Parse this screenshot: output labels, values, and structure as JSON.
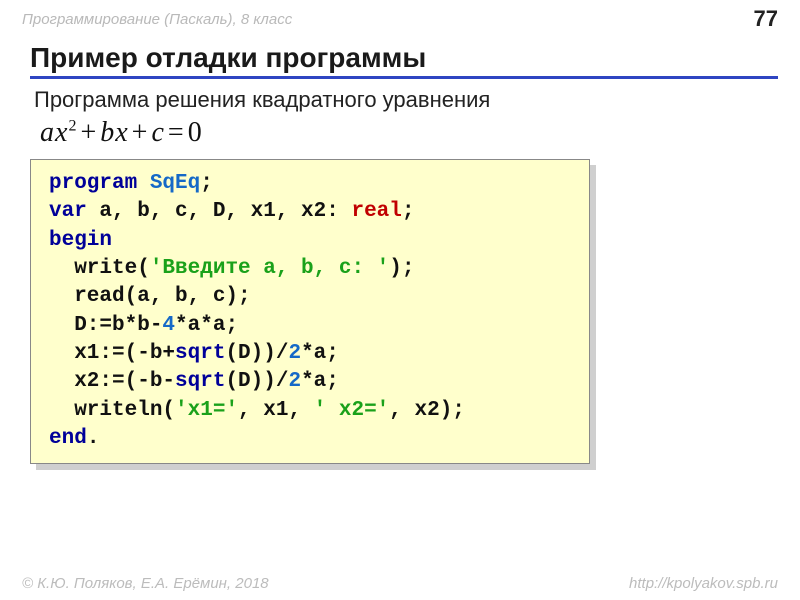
{
  "header": {
    "course": "Программирование (Паскаль), 8 класс",
    "page": "77"
  },
  "title": "Пример отладки программы",
  "subtitle": "Программа решения квадратного уравнения",
  "equation": {
    "a": "ax",
    "sup": "2",
    "plus1": "+",
    "b": "bx",
    "plus2": "+",
    "c": "c",
    "eq": "=",
    "zero": "0"
  },
  "code": {
    "kw_program": "program",
    "prog_name": "SqEq",
    "semi": ";",
    "kw_var": "var",
    "var_list": " a, b, c, D, x1, x2: ",
    "type_real": "real",
    "kw_begin": "begin",
    "l_write1": "  write(",
    "str1": "'Введите a, b, c: '",
    "l_write2": ");",
    "l_read": "  read(a, b, c);",
    "l_d1": "  D:=b*b-",
    "num4": "4",
    "l_d2": "*a*a;",
    "l_x1a": "  x1:=(-b+",
    "sqrt": "sqrt",
    "l_x1b": "(D))/",
    "num2a": "2",
    "l_x1c": "*a;",
    "l_x2a": "  x2:=(-b-",
    "l_x2b": "(D))/",
    "num2b": "2",
    "l_x2c": "*a;",
    "l_w1": "  writeln(",
    "str_x1": "'x1='",
    "l_w2": ", x1, ",
    "str_x2": "' x2='",
    "l_w3": ", x2);",
    "kw_end": "end",
    "dot": "."
  },
  "footer": {
    "authors": "© К.Ю. Поляков, Е.А. Ерёмин, 2018",
    "url": "http://kpolyakov.spb.ru"
  }
}
